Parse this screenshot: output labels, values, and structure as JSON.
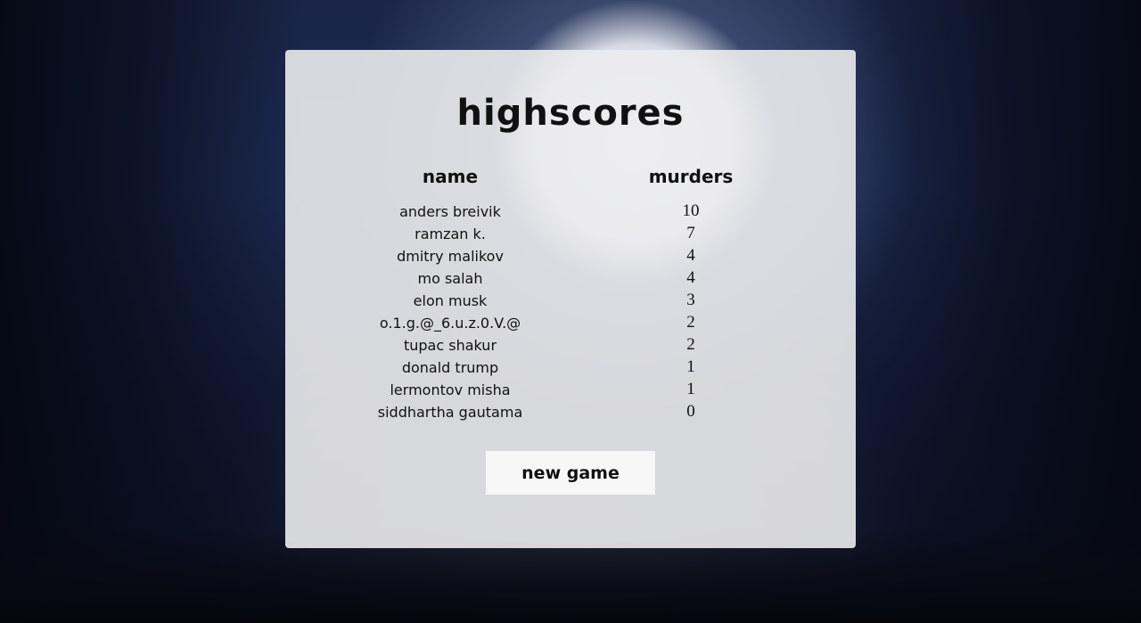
{
  "title": "highscores",
  "columns": {
    "name": "name",
    "score": "murders"
  },
  "scores": [
    {
      "name": "anders breivik",
      "murders": "10"
    },
    {
      "name": "ramzan k.",
      "murders": "7"
    },
    {
      "name": "dmitry malikov",
      "murders": "4"
    },
    {
      "name": "mo salah",
      "murders": "4"
    },
    {
      "name": "elon musk",
      "murders": "3"
    },
    {
      "name": "o.1.g.@_6.u.z.0.V.@",
      "murders": "2"
    },
    {
      "name": "tupac shakur",
      "murders": "2"
    },
    {
      "name": "donald trump",
      "murders": "1"
    },
    {
      "name": "lermontov misha",
      "murders": "1"
    },
    {
      "name": "siddhartha gautama",
      "murders": "0"
    }
  ],
  "new_game_label": "new game"
}
